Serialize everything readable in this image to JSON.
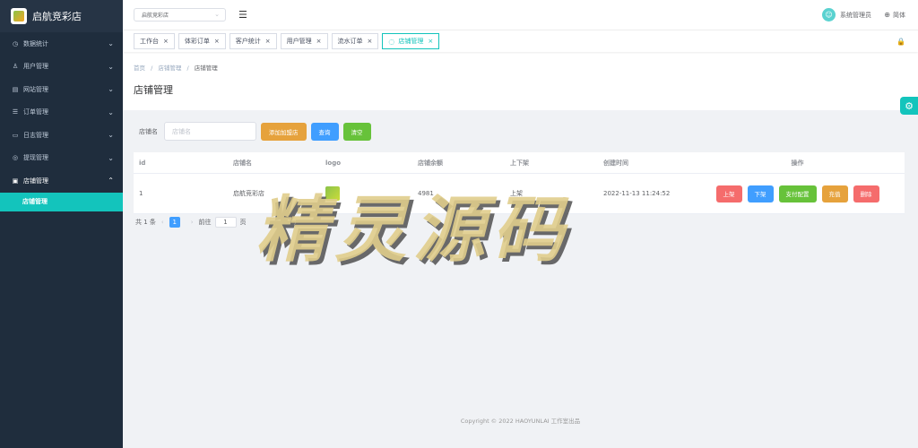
{
  "app": {
    "title": "启航竞彩店"
  },
  "sidebar": {
    "items": [
      {
        "icon": "clock-icon",
        "label": "数据统计"
      },
      {
        "icon": "user-icon",
        "label": "用户管理"
      },
      {
        "icon": "document-icon",
        "label": "网站管理"
      },
      {
        "icon": "list-icon",
        "label": "订单管理"
      },
      {
        "icon": "log-icon",
        "label": "日志管理"
      },
      {
        "icon": "withdraw-icon",
        "label": "提现管理"
      },
      {
        "icon": "shop-icon",
        "label": "店铺管理"
      }
    ],
    "sub_item": "店铺管理"
  },
  "topbar": {
    "store_select": "启航竞彩店",
    "username": "系统管理员",
    "language": "简体"
  },
  "tabs": [
    {
      "label": "工作台"
    },
    {
      "label": "体彩订单"
    },
    {
      "label": "客户统计"
    },
    {
      "label": "用户管理"
    },
    {
      "label": "流水订单"
    },
    {
      "label": "店铺管理"
    }
  ],
  "breadcrumb": [
    "首页",
    "/",
    "店铺管理",
    "/",
    "店铺管理"
  ],
  "page_title": "店铺管理",
  "search": {
    "label": "店铺名",
    "placeholder": "店铺名",
    "buttons": {
      "add": "添加加盟店",
      "query": "查询",
      "clear": "清空"
    }
  },
  "table": {
    "headers": [
      "id",
      "店铺名",
      "logo",
      "店铺余额",
      "上下架",
      "创建时间",
      "操作"
    ],
    "rows": [
      {
        "id": "1",
        "name": "启航竞彩店",
        "balance": "4981",
        "status": "上架",
        "created": "2022-11-13 11:24:52"
      }
    ],
    "ops": [
      "上架",
      "下架",
      "支付配置",
      "充值",
      "删除"
    ]
  },
  "pagination": {
    "total": "共 1 条",
    "current": "1",
    "goto_label": "前往",
    "goto_value": "1",
    "page_unit": "页"
  },
  "footer": "Copyright © 2022 HAOYUNLAI 工作室出品",
  "watermark": "精灵源码",
  "colors": {
    "sidebar": "#1f2d3d",
    "accent": "#13c4bc",
    "orange": "#e6a23c",
    "blue": "#409eff",
    "green": "#67c23a",
    "red": "#f56c6c"
  }
}
